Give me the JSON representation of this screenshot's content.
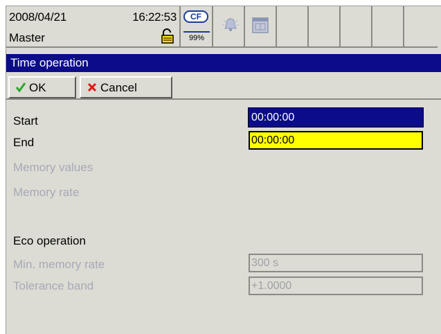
{
  "status": {
    "date": "2008/04/21",
    "time": "16:22:53",
    "user": "Master",
    "cf_label": "CF",
    "cf_percent": "99%",
    "icons": [
      "lock-icon",
      "cf-card-icon",
      "alarm-bell-icon",
      "calendar-icon"
    ]
  },
  "dialog": {
    "title": "Time operation",
    "ok_label": "OK",
    "cancel_label": "Cancel"
  },
  "fields": {
    "start_label": "Start",
    "start_value": "00:00:00",
    "end_label": "End",
    "end_value": "00:00:00",
    "memory_values_label": "Memory values",
    "memory_rate_label": "Memory rate",
    "eco_heading": "Eco operation",
    "min_memory_rate_label": "Min. memory rate",
    "min_memory_rate_value": "300 s",
    "tolerance_band_label": "Tolerance band",
    "tolerance_band_value": "+1.0000"
  },
  "colors": {
    "title_bg": "#0c0c8a",
    "selected_field_bg": "#0c0c8a",
    "edit_field_bg": "#ffff00",
    "disabled_text": "#a8a8b8",
    "panel_bg": "#dcdcd4"
  }
}
